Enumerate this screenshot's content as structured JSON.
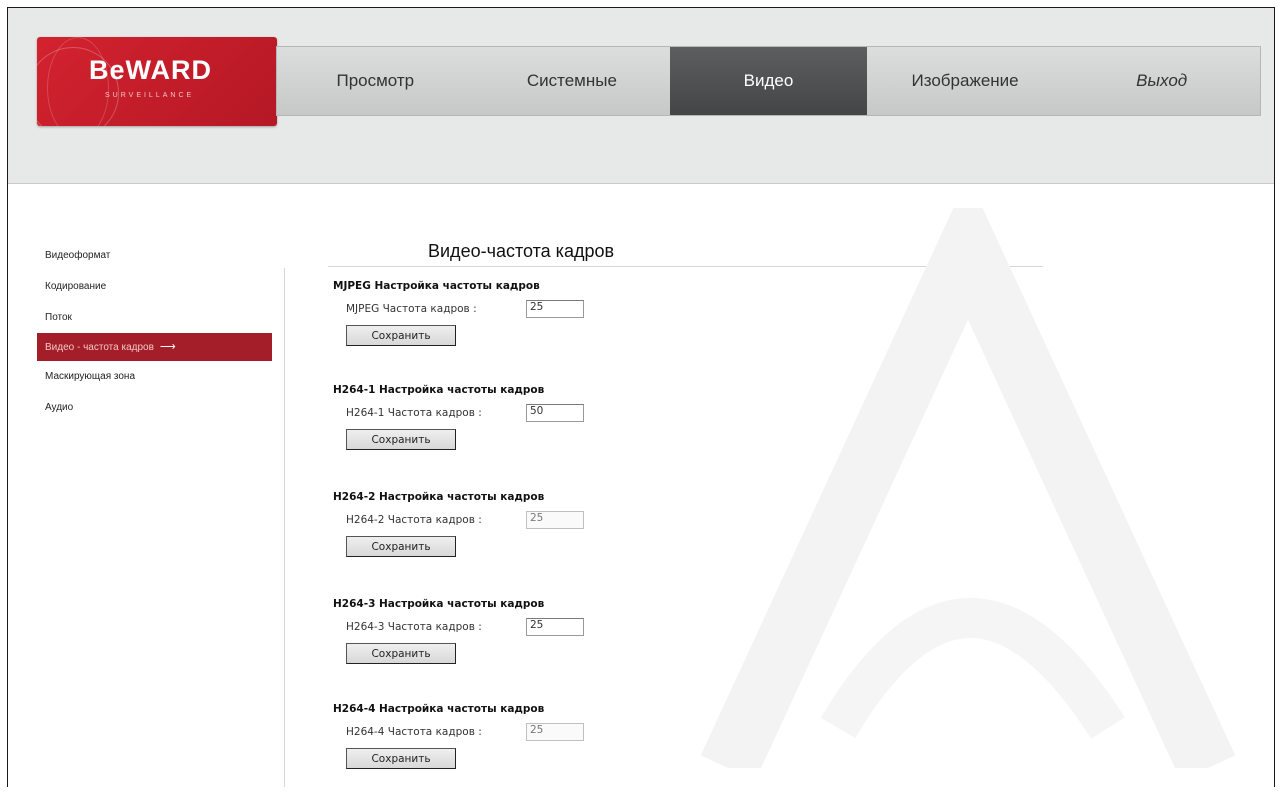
{
  "logo": {
    "text": "BeWARD",
    "sub": "SURVEILLANCE"
  },
  "nav": [
    {
      "label": "Просмотр"
    },
    {
      "label": "Системные"
    },
    {
      "label": "Видео"
    },
    {
      "label": "Изображение"
    },
    {
      "label": "Выход"
    }
  ],
  "sidebar": [
    {
      "label": "Видеоформат"
    },
    {
      "label": "Кодирование"
    },
    {
      "label": "Поток"
    },
    {
      "label": "Видео - частота кадров"
    },
    {
      "label": "Маскирующая зона"
    },
    {
      "label": "Аудио"
    }
  ],
  "page": {
    "title": "Видео-частота кадров"
  },
  "sections": [
    {
      "title": "MJPEG Настройка частоты кадров",
      "label": "MJPEG Частота кадров :",
      "value": "25",
      "button": "Сохранить"
    },
    {
      "title": "H264-1 Настройка частоты кадров",
      "label": "H264-1 Частота кадров :",
      "value": "50",
      "button": "Сохранить"
    },
    {
      "title": "H264-2 Настройка частоты кадров",
      "label": "H264-2 Частота кадров :",
      "value": "25",
      "button": "Сохранить"
    },
    {
      "title": "H264-3 Настройка частоты кадров",
      "label": "H264-3 Частота кадров :",
      "value": "25",
      "button": "Сохранить"
    },
    {
      "title": "H264-4 Настройка частоты кадров",
      "label": "H264-4 Частота кадров :",
      "value": "25",
      "button": "Сохранить"
    }
  ],
  "colors": {
    "brand_red": "#c41e2a",
    "nav_active": "#4f5051",
    "sidebar_active": "#a31e28"
  }
}
